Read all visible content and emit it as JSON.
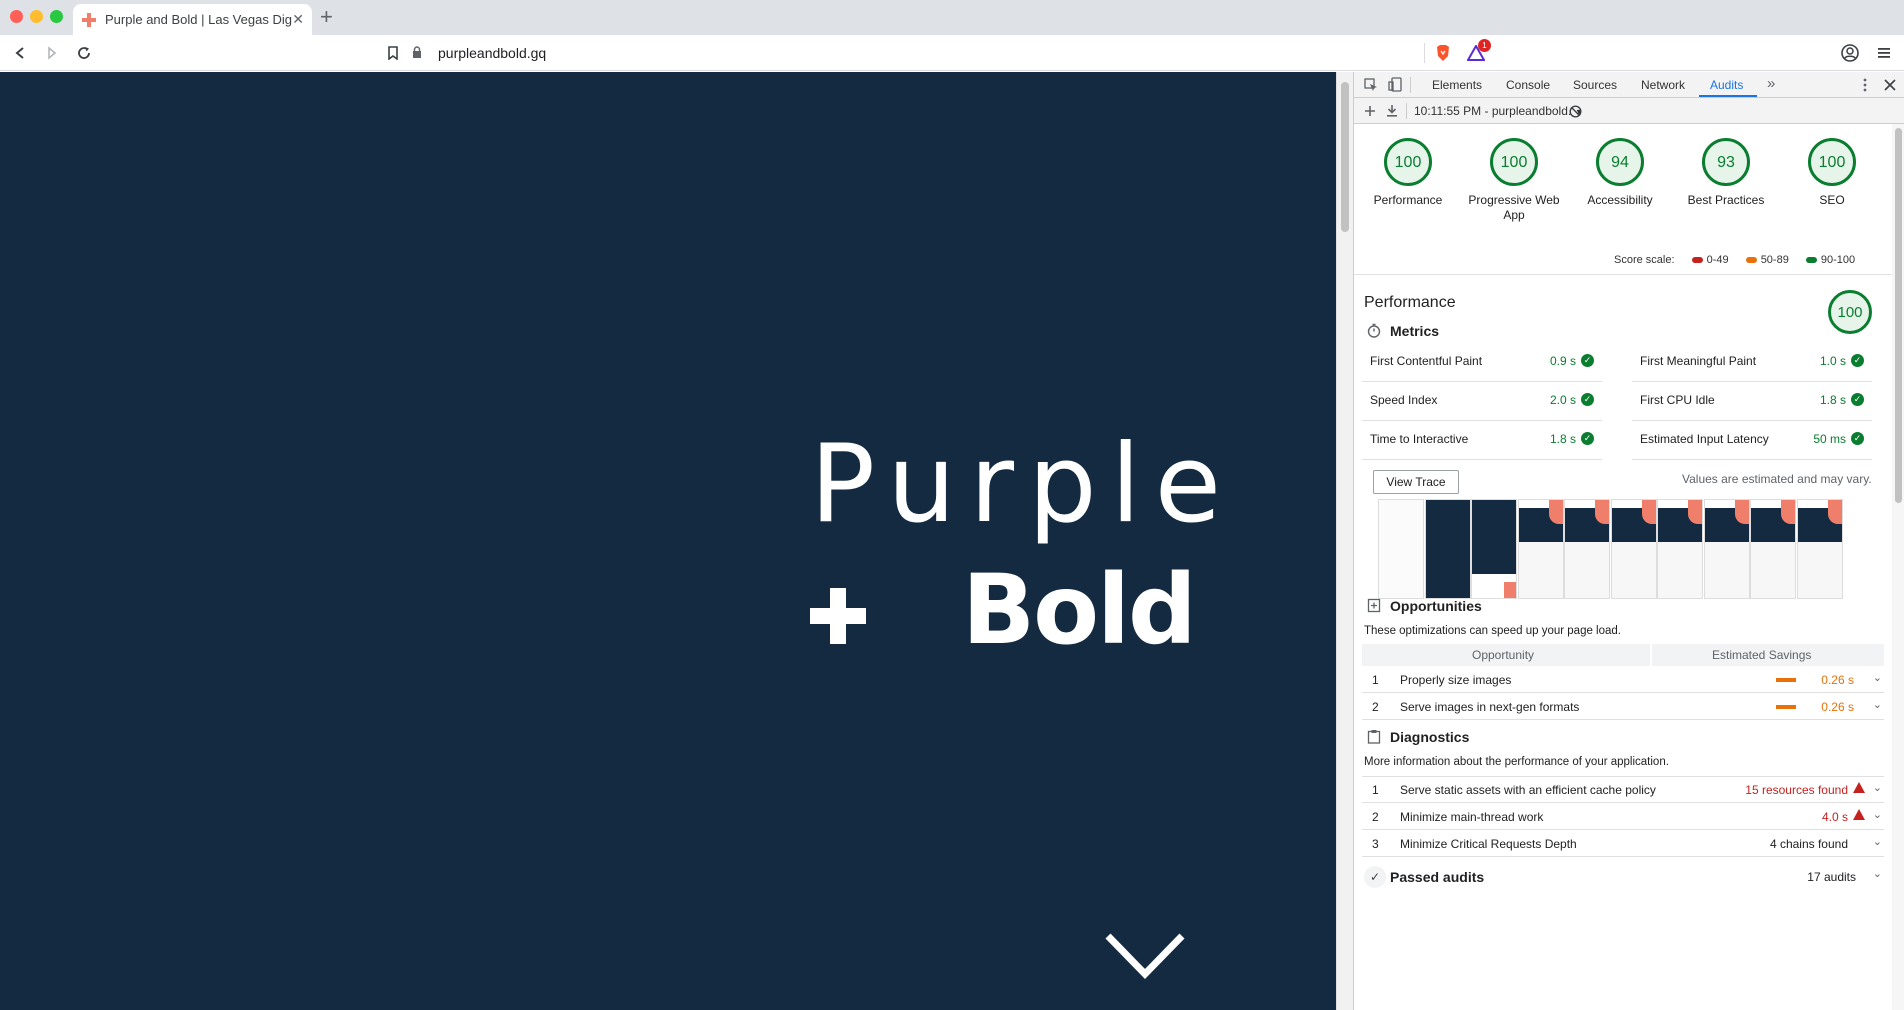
{
  "browser": {
    "tab_title": "Purple and Bold | Las Vegas Dig",
    "tab_close": "✕",
    "new_tab": "+",
    "url": "purpleandbold.gq",
    "alert_badge": "1"
  },
  "hero": {
    "line1": "Purple",
    "line2": "Bold"
  },
  "devtools": {
    "tabs": [
      "Elements",
      "Console",
      "Sources",
      "Network",
      "Audits"
    ],
    "more": "»",
    "report_selector": "10:11:55 PM - purpleandbold.",
    "dropdown_caret": "▾"
  },
  "gauges": [
    {
      "score": "100",
      "label": "Performance"
    },
    {
      "score": "100",
      "label": "Progressive Web App"
    },
    {
      "score": "94",
      "label": "Accessibility"
    },
    {
      "score": "93",
      "label": "Best Practices"
    },
    {
      "score": "100",
      "label": "SEO"
    }
  ],
  "scale": {
    "label": "Score scale:",
    "bad": "0-49",
    "avg": "50-89",
    "good": "90-100",
    "colors": {
      "bad": "#c5221f",
      "avg": "#e8710a",
      "good": "#0a7d30"
    }
  },
  "performance": {
    "title": "Performance",
    "score": "100",
    "metrics_title": "Metrics",
    "metrics": [
      {
        "label": "First Contentful Paint",
        "value": "0.9 s"
      },
      {
        "label": "First Meaningful Paint",
        "value": "1.0 s"
      },
      {
        "label": "Speed Index",
        "value": "2.0 s"
      },
      {
        "label": "First CPU Idle",
        "value": "1.8 s"
      },
      {
        "label": "Time to Interactive",
        "value": "1.8 s"
      },
      {
        "label": "Estimated Input Latency",
        "value": "50 ms"
      }
    ],
    "note": "Values are estimated and may vary.",
    "view_trace": "View Trace"
  },
  "opportunities": {
    "title": "Opportunities",
    "desc": "These optimizations can speed up your page load.",
    "col1": "Opportunity",
    "col2": "Estimated Savings",
    "items": [
      {
        "n": "1",
        "label": "Properly size images",
        "value": "0.26 s"
      },
      {
        "n": "2",
        "label": "Serve images in next-gen formats",
        "value": "0.26 s"
      }
    ]
  },
  "diagnostics": {
    "title": "Diagnostics",
    "desc": "More information about the performance of your application.",
    "items": [
      {
        "n": "1",
        "label": "Serve static assets with an efficient cache policy",
        "value": "15 resources found"
      },
      {
        "n": "2",
        "label": "Minimize main-thread work",
        "value": "4.0 s"
      },
      {
        "n": "3",
        "label": "Minimize Critical Requests Depth",
        "value": "4 chains found"
      }
    ]
  },
  "passed": {
    "title": "Passed audits",
    "count": "17 audits"
  }
}
